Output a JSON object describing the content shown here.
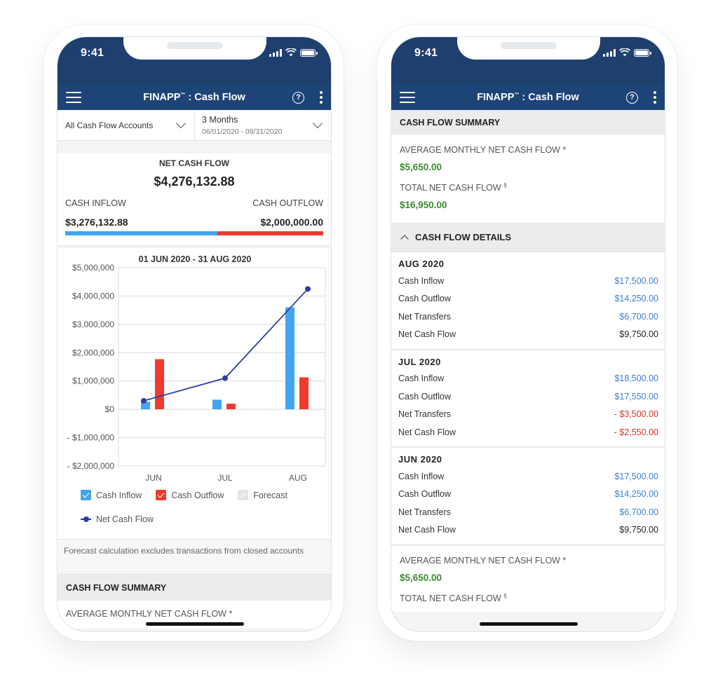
{
  "colors": {
    "header": "#1f3f6e",
    "navbar": "#1d4476",
    "inflow": "#42a5f0",
    "outflow": "#ef3b2f",
    "net_line": "#2d3fa5",
    "positive_green": "#3a8a2e",
    "link_blue": "#3b7fcf",
    "negative_red": "#d0332b"
  },
  "status_bar": {
    "time": "9:41"
  },
  "app": {
    "title_brand": "FINAPP",
    "title_tm": "™",
    "title_rest": " : Cash Flow"
  },
  "icons": {
    "menu": "hamburger-icon",
    "help": "help-icon",
    "more": "kebab-icon"
  },
  "left_screen": {
    "account_filter": {
      "value": "All Cash Flow Accounts"
    },
    "range_filter": {
      "value": "3 Months",
      "dates": "06/01/2020 - 08/31/2020"
    },
    "net_cash_flow": {
      "label": "NET CASH FLOW",
      "value": "$4,276,132.88",
      "inflow_label": "CASH INFLOW",
      "outflow_label": "CASH OUTFLOW",
      "inflow_value": "$3,276,132.88",
      "outflow_value": "$2,000,000.00",
      "inflow_fraction": 0.59
    },
    "legend": {
      "inflow": "Cash Inflow",
      "outflow": "Cash Outflow",
      "forecast": "Forecast",
      "net": "Net Cash Flow"
    },
    "footnote": "Forecast calculation excludes transactions from closed accounts",
    "summary_header": "CASH FLOW SUMMARY",
    "avg_label": "AVERAGE MONTHLY NET CASH FLOW",
    "avg_mark": " *"
  },
  "chart_data": {
    "type": "bar",
    "title": "01 JUN 2020 - 31 AUG 2020",
    "categories": [
      "JUN",
      "JUL",
      "AUG"
    ],
    "series": [
      {
        "name": "Cash Inflow",
        "type": "bar",
        "values": [
          270000,
          340000,
          3600000
        ]
      },
      {
        "name": "Cash Outflow",
        "type": "bar",
        "values": [
          1770000,
          200000,
          1130000
        ]
      },
      {
        "name": "Net Cash Flow",
        "type": "line",
        "values": [
          300000,
          1100000,
          4250000
        ]
      }
    ],
    "ylim": [
      -2000000,
      5000000
    ],
    "yticks": [
      5000000,
      4000000,
      3000000,
      2000000,
      1000000,
      0,
      -1000000,
      -2000000
    ],
    "ytick_labels": [
      "$5,000,000",
      "$4,000,000",
      "$3,000,000",
      "$2,000,000",
      "$1,000,000",
      "$0",
      "- $1,000,000",
      "- $2,000,000"
    ],
    "grid": true,
    "legend_position": "bottom"
  },
  "right_screen": {
    "summary_header": "CASH FLOW SUMMARY",
    "avg_label": "AVERAGE MONTHLY NET CASH FLOW",
    "avg_mark": " *",
    "avg_value": "$5,650.00",
    "total_label": "TOTAL NET CASH FLOW",
    "total_mark": "§",
    "total_value": "$16,950.00",
    "details_header": "CASH FLOW DETAILS",
    "months": [
      {
        "title": "AUG 2020",
        "rows": [
          {
            "label": "Cash Inflow",
            "value": "$17,500.00",
            "tone": "blue"
          },
          {
            "label": "Cash Outflow",
            "value": "$14,250.00",
            "tone": "blue"
          },
          {
            "label": "Net Transfers",
            "value": "$6,700.00",
            "tone": "blue"
          },
          {
            "label": "Net Cash Flow",
            "value": "$9,750.00",
            "tone": "dark"
          }
        ]
      },
      {
        "title": "JUL 2020",
        "rows": [
          {
            "label": "Cash Inflow",
            "value": "$18,500.00",
            "tone": "blue"
          },
          {
            "label": "Cash Outflow",
            "value": "$17,550.00",
            "tone": "blue"
          },
          {
            "label": "Net Transfers",
            "value": "- $3,500.00",
            "tone": "red"
          },
          {
            "label": "Net Cash Flow",
            "value": "- $2,550.00",
            "tone": "red"
          }
        ]
      },
      {
        "title": "JUN 2020",
        "rows": [
          {
            "label": "Cash Inflow",
            "value": "$17,500.00",
            "tone": "blue"
          },
          {
            "label": "Cash Outflow",
            "value": "$14,250.00",
            "tone": "blue"
          },
          {
            "label": "Net Transfers",
            "value": "$6,700.00",
            "tone": "blue"
          },
          {
            "label": "Net Cash Flow",
            "value": "$9,750.00",
            "tone": "dark"
          }
        ]
      }
    ],
    "summary2": {
      "avg_label": "AVERAGE MONTHLY NET CASH FLOW",
      "avg_mark": " *",
      "avg_value": "$5,650.00",
      "total_label": "TOTAL NET CASH FLOW",
      "total_mark": "§"
    }
  }
}
